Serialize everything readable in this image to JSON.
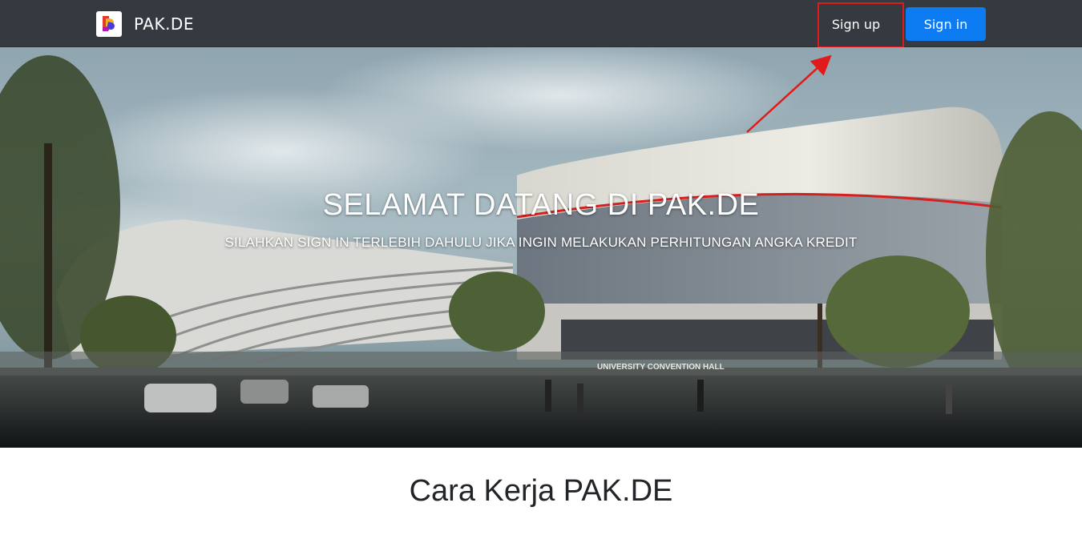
{
  "navbar": {
    "brand_name": "PAK.DE",
    "brand_logo_icon": "pakde-logo-icon",
    "signup_label": "Sign up",
    "signin_label": "Sign in",
    "background_color": "#343a40",
    "signin_color": "#0d7cf2"
  },
  "hero": {
    "title": "SELAMAT DATANG DI PAK.DE",
    "subtitle": "SILAHKAN SIGN IN TERLEBIH DAHULU JIKA INGIN MELAKUKAN PERHITUNGAN ANGKA KREDIT",
    "image_sign_text": "UNIVERSITY CONVENTION HALL"
  },
  "section": {
    "title": "Cara Kerja PAK.DE"
  },
  "annotation": {
    "highlight_color": "#e11b1b"
  }
}
